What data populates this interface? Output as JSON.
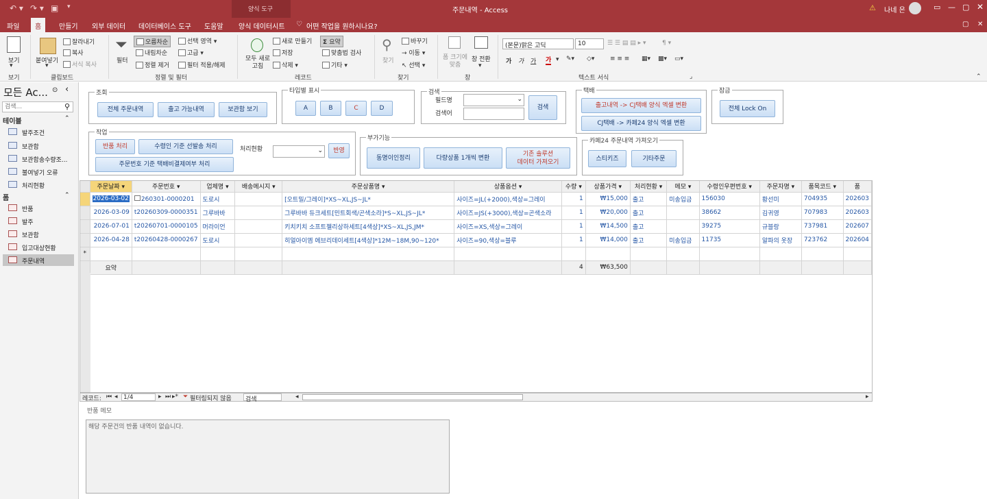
{
  "titlebar": {
    "context_tab": "양식 도구",
    "title": "주문내역  -  Access",
    "user": "나네 은",
    "warn": "⚠"
  },
  "tabs": [
    "파일",
    "홈",
    "만들기",
    "외부 데이터",
    "데이터베이스 도구",
    "도움말",
    "양식 데이터시트"
  ],
  "tellme": "어떤 작업을 원하시나요?",
  "ribbon": {
    "view": "보기",
    "view_group": "보기",
    "paste": "붙여넣기",
    "cut": "잘라내기",
    "copy": "복사",
    "format_painter": "서식 복사",
    "clipboard_group": "클립보드",
    "filter": "필터",
    "asc": "오름차순",
    "desc": "내림차순",
    "remove_sort": "정렬 제거",
    "selection": "선택 영역",
    "advanced": "고급",
    "toggle_filter": "필터 적용/해제",
    "sort_group": "정렬 및 필터",
    "refresh": "모두 새로 고침",
    "new": "새로 만들기",
    "save": "저장",
    "delete": "삭제",
    "totals": "요약",
    "spelling": "맞춤법 검사",
    "more": "기타",
    "records_group": "레코드",
    "find": "찾기",
    "replace": "바꾸기",
    "goto": "이동",
    "select": "선택",
    "find_group": "찾기",
    "size_to_fit": "폼 크기에 맞춤",
    "switch_windows": "창 전환",
    "window_group": "창",
    "font": "(본문)맑은 고딕",
    "font_size": "10",
    "text_group": "텍스트 서식"
  },
  "nav": {
    "title": "모든 Ac...",
    "search_placeholder": "검색...",
    "sections": [
      {
        "name": "테이블",
        "items": [
          "발주조건",
          "보관함",
          "보관함송수량조...",
          "불여넣기 오류",
          "처리현황"
        ]
      },
      {
        "name": "폼",
        "items": [
          "반품",
          "발주",
          "보관함",
          "입고대상현황",
          "주문내역"
        ]
      }
    ]
  },
  "form": {
    "lookup_legend": "조회",
    "all_orders": "전체 주문내역",
    "shippable": "출고 가능내역",
    "view_storage": "보관함 보기",
    "type_legend": "타입별 표시",
    "types": [
      "A",
      "B",
      "C",
      "D"
    ],
    "search_legend": "검색",
    "field_name_label": "필드명",
    "search_term_label": "검색어",
    "search_button": "검색",
    "courier_legend": "택배",
    "courier_btn1": "출고내역 -> CJ택배 양식 엑셀 변환",
    "courier_btn2": "CJ택배 -> 카페24 양식 엑셀 변환",
    "lock_legend": "잠금",
    "lock_button": "전체 Lock On",
    "work_legend": "작업",
    "return_process": "반품 처리",
    "recipient_shipping": "수령인 기준 선발송 처리",
    "status_label": "처리현황",
    "apply_button": "반영",
    "order_shipping_cost": "주문번호 기준 택배비결제여부 처리",
    "extra_legend": "부가기능",
    "same_name": "동명이인정리",
    "multi_item": "다량상품 1개씩 변환",
    "legacy_import": "기존 솔루션\n데이터 가져오기",
    "cafe24_legend": "카페24 주문내역 가져오기",
    "stickys": "스티키즈",
    "other_orders": "기타주문"
  },
  "grid": {
    "columns": [
      "주문날짜",
      "주문번호",
      "업체명",
      "배송메시지",
      "주문상품명",
      "상품옵션",
      "수량",
      "상품가격",
      "처리현황",
      "메모",
      "수령인우편번호",
      "주문자명",
      "품목코드",
      "품"
    ],
    "rows": [
      [
        "2026-03-02",
        "260301-0000201",
        "도로시",
        "",
        "[오트밀/그레이]*XS~XL,JS~JL*",
        "사이즈=JL(+2000),색상=그레이",
        "1",
        "₩15,000",
        "출고",
        "미송입금",
        "156030",
        "황선미",
        "704935",
        "202603"
      ],
      [
        "2026-03-09",
        "t20260309-0000351",
        "그루바바",
        "",
        "그루바바 듀크세트[민트회색/곤색소라]*S~XL,JS~JL*",
        "사이즈=JS(+3000),색상=곤색소라",
        "1",
        "₩20,000",
        "출고",
        "",
        "38662",
        "김귀영",
        "707983",
        "202603"
      ],
      [
        "2026-07-01",
        "t20260701-0000105",
        "머라이언",
        "",
        "키치키치 소프트젤리상하세트[4색상]*XS~XL,JS,JM*",
        "사이즈=XS,색상=그레이",
        "1",
        "₩14,500",
        "출고",
        "",
        "39275",
        "규블랑",
        "737981",
        "202607"
      ],
      [
        "2026-04-28",
        "t20260428-0000267",
        "도로시",
        "",
        "히얼아이엠 에브리데이세트[4색상]*12M~18M,90~120*",
        "사이즈=90,색상=블루",
        "1",
        "₩14,000",
        "출고",
        "미송입금",
        "11735",
        "알파의 옷장",
        "723762",
        "202604"
      ]
    ],
    "new_row_marker": "*",
    "totals_label": "요약",
    "total_qty": "4",
    "total_price": "₩63,500"
  },
  "recnav": {
    "label": "레코드:",
    "position": "1/4",
    "filter_status": "필터링되지 않음",
    "search": "검색"
  },
  "memo": {
    "label": "반품 메모",
    "text": "해당 주문건의 반품 내역이 없습니다."
  }
}
